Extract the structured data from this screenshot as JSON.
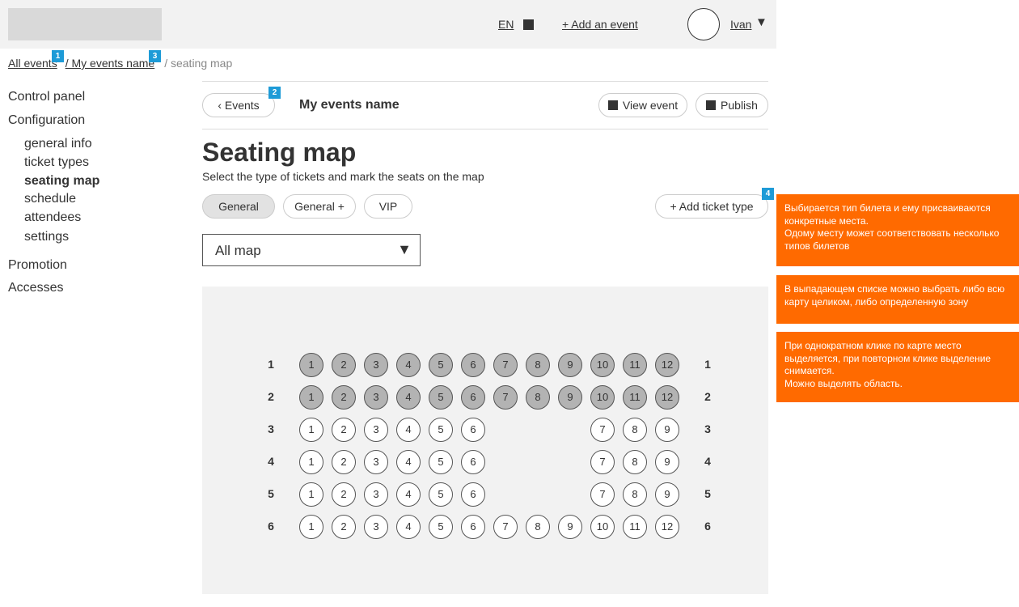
{
  "header": {
    "lang": "EN",
    "add_event": "+ Add an event",
    "user": "Ivan",
    "user_caret": "▼"
  },
  "breadcrumb": {
    "all_events": "All events",
    "event": "/ My events name",
    "current": "/ seating map"
  },
  "markers": [
    "1",
    "2",
    "3",
    "4"
  ],
  "sidebar": {
    "control_panel": "Control panel",
    "configuration": "Configuration",
    "sub_items": [
      {
        "label": "general info",
        "active": false
      },
      {
        "label": "ticket types",
        "active": false
      },
      {
        "label": "seating map",
        "active": true
      },
      {
        "label": "schedule",
        "active": false
      },
      {
        "label": "attendees",
        "active": false
      },
      {
        "label": "settings",
        "active": false
      }
    ],
    "promotion": "Promotion",
    "accesses": "Accesses"
  },
  "event_bar": {
    "back": "‹ Events",
    "event_name": "My events name",
    "view": "View event",
    "publish": "Publish"
  },
  "page": {
    "title": "Seating map",
    "subtitle": "Select the type of tickets and mark the seats on the map"
  },
  "ticket_types": {
    "items": [
      "General",
      "General +",
      "VIP"
    ],
    "selected": "General",
    "add": "+ Add ticket type"
  },
  "zone_select": {
    "value": "All map",
    "caret": "▼"
  },
  "seating": {
    "rows": [
      {
        "label": "1",
        "seats": [
          "1",
          "2",
          "3",
          "4",
          "5",
          "6",
          "7",
          "8",
          "9",
          "10",
          "11",
          "12"
        ],
        "taken": true
      },
      {
        "label": "2",
        "seats": [
          "1",
          "2",
          "3",
          "4",
          "5",
          "6",
          "7",
          "8",
          "9",
          "10",
          "11",
          "12"
        ],
        "taken": true
      },
      {
        "label": "3",
        "seats": [
          "1",
          "2",
          "3",
          "4",
          "5",
          "6",
          "",
          "",
          "",
          "7",
          "8",
          "9"
        ],
        "taken": false
      },
      {
        "label": "4",
        "seats": [
          "1",
          "2",
          "3",
          "4",
          "5",
          "6",
          "",
          "",
          "",
          "7",
          "8",
          "9"
        ],
        "taken": false
      },
      {
        "label": "5",
        "seats": [
          "1",
          "2",
          "3",
          "4",
          "5",
          "6",
          "",
          "",
          "",
          "7",
          "8",
          "9"
        ],
        "taken": false
      },
      {
        "label": "6",
        "seats": [
          "1",
          "2",
          "3",
          "4",
          "5",
          "6",
          "7",
          "8",
          "9",
          "10",
          "11",
          "12"
        ],
        "taken": false
      }
    ]
  },
  "notes": [
    "Выбирается тип билета и ему присваиваются конкретные места.\nОдому месту может соответствовать несколько типов билетов",
    "В выпадающем списке можно выбрать либо всю карту целиком, либо определенную зону",
    "При однократном клике по карте место выделяется, при повторном клике выделение снимается.\nМожно выделять область."
  ],
  "colors": {
    "note_bg": "#ff6a00",
    "marker": "#1e9bd7",
    "taken_seat": "#b3b3b3"
  }
}
